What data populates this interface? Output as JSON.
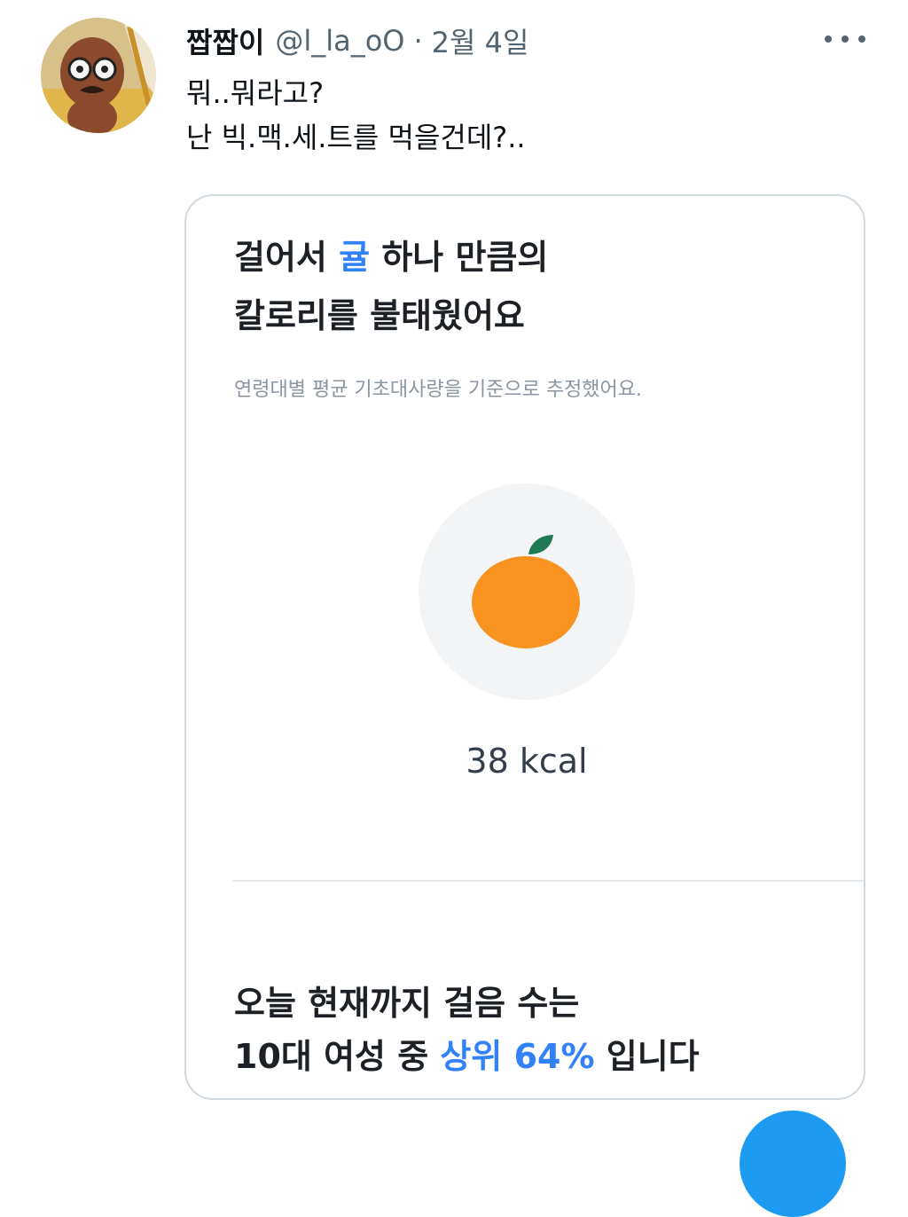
{
  "tweet": {
    "display_name": "짭짭이",
    "handle": "@l_la_oO",
    "separator": "·",
    "date": "2월 4일",
    "lines": [
      "뭐..뭐라고?",
      "난 빅.맥.세.트를 먹을건데?.."
    ]
  },
  "card": {
    "headline_part1": "걸어서 ",
    "headline_accent": "귤",
    "headline_part2": " 하나 만큼의",
    "headline_line2": "칼로리를 불태웠어요",
    "subtext": "연령대별 평균 기초대사량을 기준으로 추정했어요.",
    "calories": "38 kcal",
    "bottom_line1": "오늘 현재까지 걸음 수는",
    "bottom_line2_part1": "10대 여성 중 ",
    "bottom_line2_accent": "상위 64%",
    "bottom_line2_part2": " 입니다",
    "accent_color": "#3182f6",
    "fruit_color": "#f7931e",
    "leaf_color": "#1f7a55"
  },
  "icons": {
    "more": "more-horizontal-icon",
    "avatar": "profile-avatar",
    "fab": "compose-button"
  },
  "colors": {
    "secondary_text": "#536471",
    "card_border": "#cfd9de",
    "fab": "#1d9bf0"
  }
}
